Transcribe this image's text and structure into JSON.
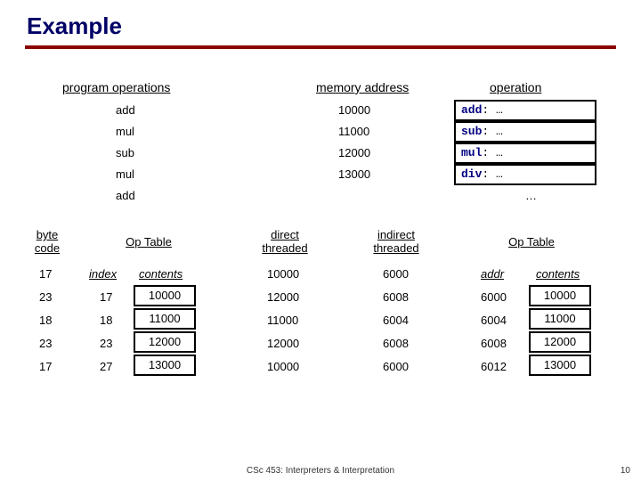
{
  "title": "Example",
  "headers": {
    "program_ops": "program operations",
    "mem_addr": "memory address",
    "operation": "operation",
    "byte_code": "byte code",
    "op_table_left": "Op Table",
    "direct_threaded": "direct threaded",
    "indirect_threaded": "indirect threaded",
    "op_table_right": "Op Table",
    "index": "index",
    "contents_l": "contents",
    "addr": "addr",
    "contents_r": "contents"
  },
  "prog_ops": [
    "add",
    "mul",
    "sub",
    "mul",
    "add"
  ],
  "mem_addrs": [
    "10000",
    "11000",
    "12000",
    "13000"
  ],
  "ops": [
    {
      "kw": "add",
      "rest": ": …"
    },
    {
      "kw": "sub",
      "rest": ": …"
    },
    {
      "kw": "mul",
      "rest": ": …"
    },
    {
      "kw": "div",
      "rest": ": …"
    }
  ],
  "op_trailing": "…",
  "byte_codes": [
    "17",
    "23",
    "18",
    "23",
    "17"
  ],
  "op_table_left": {
    "index": [
      "17",
      "18",
      "23",
      "27"
    ],
    "contents": [
      "10000",
      "11000",
      "12000",
      "13000"
    ]
  },
  "direct_threaded": [
    "10000",
    "12000",
    "11000",
    "12000",
    "10000"
  ],
  "indirect_threaded": [
    "6000",
    "6008",
    "6004",
    "6008",
    "6000"
  ],
  "op_table_right": {
    "addr": [
      "6000",
      "6004",
      "6008",
      "6012"
    ],
    "contents": [
      "10000",
      "11000",
      "12000",
      "13000"
    ]
  },
  "footer_center": "CSc 453: Interpreters & Interpretation",
  "footer_right": "10"
}
